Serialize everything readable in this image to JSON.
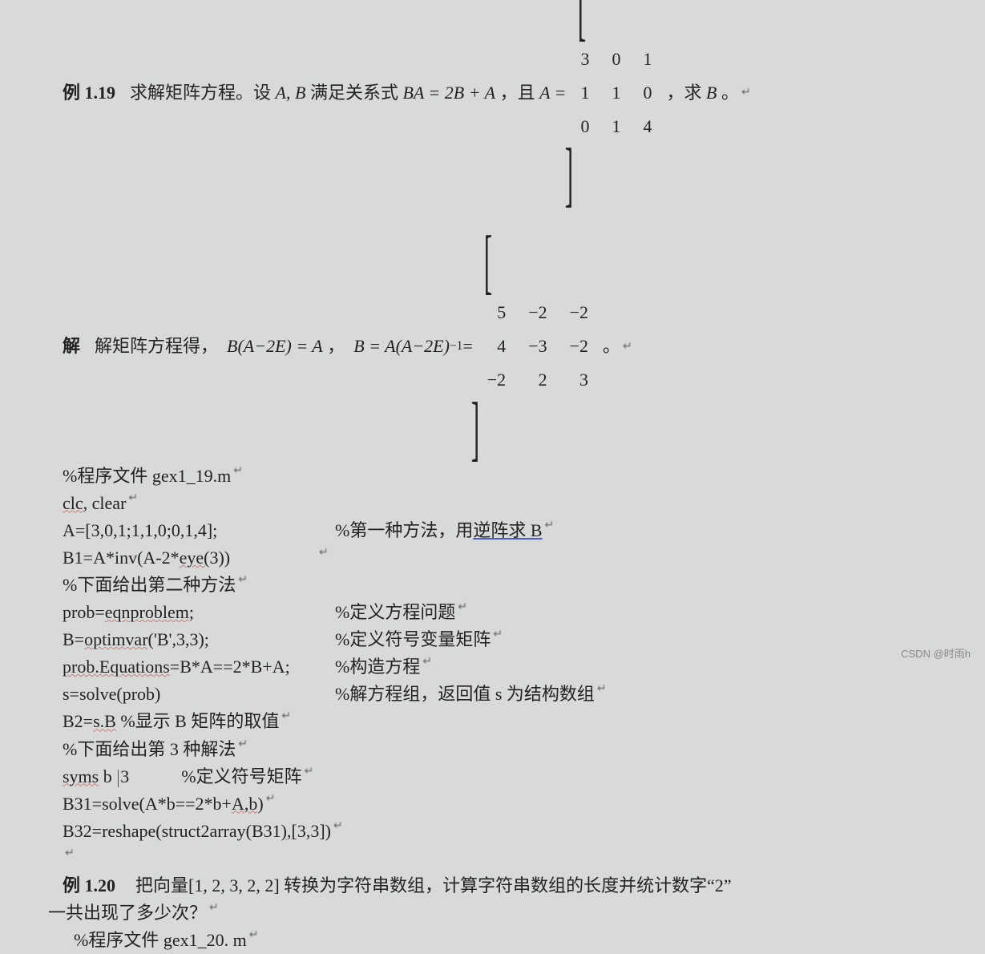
{
  "ex119": {
    "label": "例 1.19",
    "prompt_pre": "求解矩阵方程。设",
    "prompt_mid": "满足关系式",
    "eqn": "BA = 2B + A",
    "prompt_and": "，且",
    "A_eq": "A =",
    "prompt_find": "，求",
    "period": "。",
    "matrix_A": [
      [
        "3",
        "0",
        "1"
      ],
      [
        "1",
        "1",
        "0"
      ],
      [
        "0",
        "1",
        "4"
      ]
    ]
  },
  "sol119": {
    "label": "解",
    "text1": "解矩阵方程得，",
    "eqn1": "B(A−2E) = A",
    "eqn2_pre": "，",
    "eqn2": "B = A(A−2E)",
    "inv": "−1",
    "eq": " =",
    "period": "。",
    "matrix_B": [
      [
        "5",
        "−2",
        "−2"
      ],
      [
        "4",
        "−3",
        "−2"
      ],
      [
        "−2",
        "2",
        "3"
      ]
    ]
  },
  "code": {
    "c01": "%程序文件 gex1_19.m",
    "c02a": "clc",
    "c02b": ", clear",
    "c03": "A=[3,0,1;1,1,0;0,1,4];",
    "c03r": "%第一种方法，用",
    "c03r_u": "逆阵求 B",
    "c04a": "B1=A*inv(A-2*",
    "c04b": "eye(",
    "c04c": "3))",
    "c05": "%下面给出第二种方法",
    "c06a": "prob=",
    "c06b": "eqnproblem",
    "c06c": ";",
    "c06r": "%定义方程问题",
    "c07a": "B=",
    "c07b": "optimvar",
    "c07c": "('B',3,3);",
    "c07r": "%定义符号变量矩阵",
    "c08a": "prob.Equations",
    "c08b": "=B*A==2*B+A;",
    "c08r": "%构造方程",
    "c09": "s=solve(prob)",
    "c09r": "%解方程组，返回值 s  为结构数组",
    "c10a": "B2=",
    "c10b": "s.B",
    "c10c": " %显示 B  矩阵的取值",
    "c11": "%下面给出第 3 种解法",
    "c12a": "syms",
    "c12b": " b ",
    "c12c": "3",
    "c12r": "%定义符号矩阵",
    "c13a": "B31=solve(A*b==2*b+",
    "c13b": "A,b",
    "c13c": ")",
    "c14a": "B32=reshape(struct2array(B31",
    "c14b": "),[",
    "c14c": "3,3])"
  },
  "ex120": {
    "label": "例  1.20",
    "text1": "把向量[1, 2, 3, 2, 2] 转换为字符串数组，计算字符串数组的长度并统计数字“2”",
    "text2": "一共出现了多少次？",
    "c01": "%程序文件 gex1_20. m"
  },
  "watermark": "CSDN @时雨h"
}
